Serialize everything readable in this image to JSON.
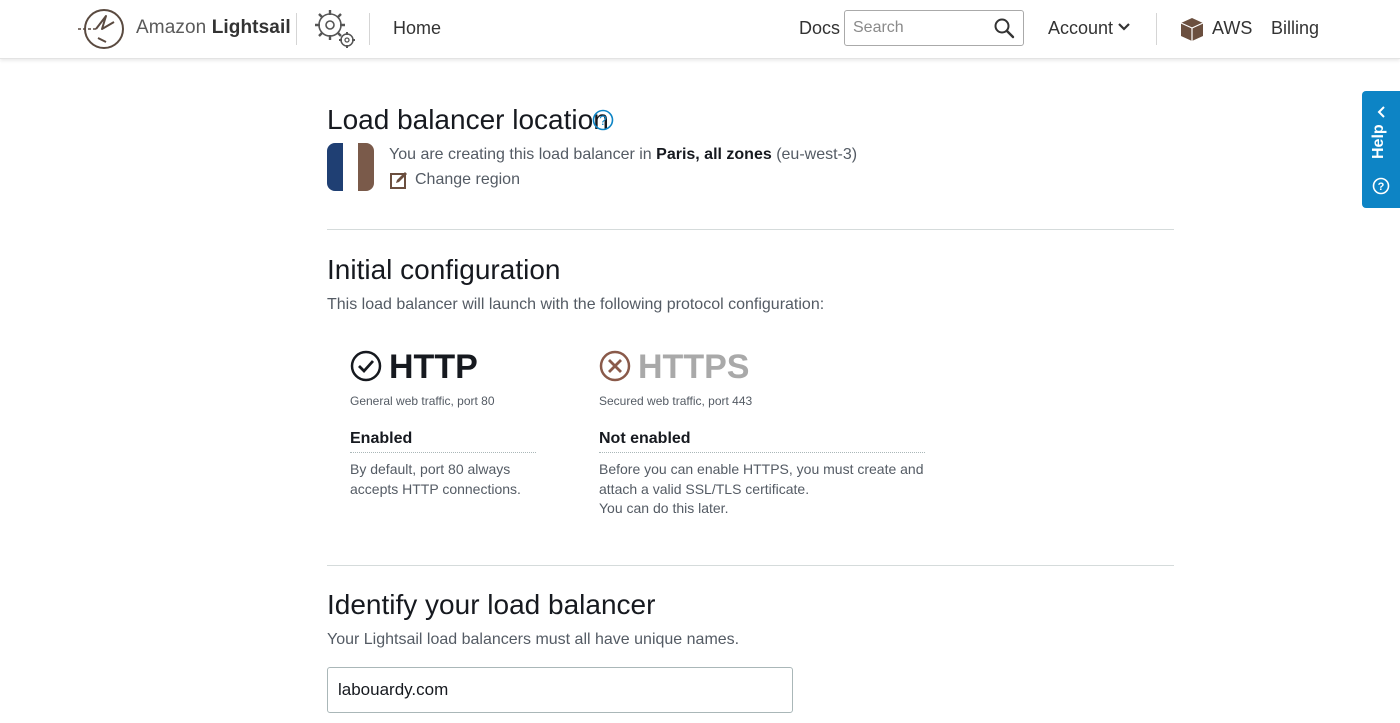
{
  "header": {
    "brand_prefix": "Amazon ",
    "brand_name": "Lightsail",
    "home": "Home",
    "docs": "Docs",
    "search_placeholder": "Search",
    "account": "Account",
    "aws": "AWS",
    "billing": "Billing"
  },
  "help_tab": {
    "label": "Help"
  },
  "location": {
    "title": "Load balancer location",
    "text_prefix": "You are creating this load balancer in ",
    "region_name": "Paris, all zones",
    "region_code": " (eu-west-3)",
    "change_region": "Change region",
    "flag_colors": [
      "#1f3f73",
      "#ffffff",
      "#7a5a4a"
    ]
  },
  "initial_config": {
    "title": "Initial configuration",
    "subtitle": "This load balancer will launch with the following protocol configuration:",
    "protocols": [
      {
        "name": "HTTP",
        "desc": "General web traffic, port 80",
        "status": "Enabled",
        "note_lines": [
          "By default, port 80 always",
          "accepts HTTP connections."
        ],
        "icon": "check-circle-icon"
      },
      {
        "name": "HTTPS",
        "desc": "Secured web traffic, port 443",
        "status": "Not enabled",
        "note_lines": [
          "Before you can enable HTTPS, you must create and",
          "attach a valid SSL/TLS certificate.",
          "You can do this later."
        ],
        "icon": "x-circle-icon"
      }
    ]
  },
  "identify": {
    "title": "Identify your load balancer",
    "subtitle": "Your Lightsail load balancers must all have unique names.",
    "name_value": "labouardy.com"
  },
  "colors": {
    "accent_blue": "#0d84c5",
    "https_muted": "#a9a9a9",
    "x_icon": "#8a5a4a"
  }
}
